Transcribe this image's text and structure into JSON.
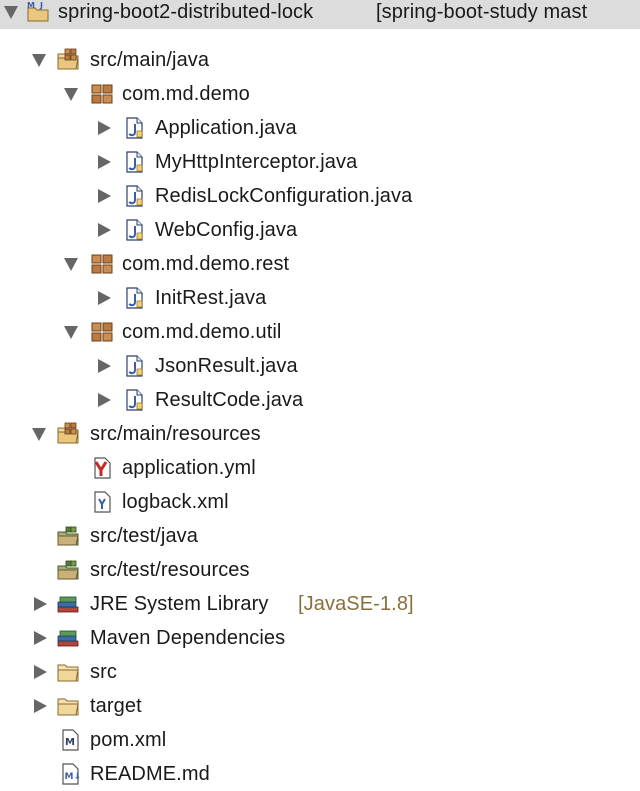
{
  "tree": {
    "project": {
      "label": "spring-boot2-distributed-lock",
      "decoration": "[spring-boot-study mast"
    },
    "items": [
      {
        "label": "src/main/java"
      },
      {
        "label": "com.md.demo"
      },
      {
        "label": "Application.java"
      },
      {
        "label": "MyHttpInterceptor.java"
      },
      {
        "label": "RedisLockConfiguration.java"
      },
      {
        "label": "WebConfig.java"
      },
      {
        "label": "com.md.demo.rest"
      },
      {
        "label": "InitRest.java"
      },
      {
        "label": "com.md.demo.util"
      },
      {
        "label": "JsonResult.java"
      },
      {
        "label": "ResultCode.java"
      },
      {
        "label": "src/main/resources"
      },
      {
        "label": "application.yml"
      },
      {
        "label": "logback.xml"
      },
      {
        "label": "src/test/java"
      },
      {
        "label": "src/test/resources"
      },
      {
        "label": "JRE System Library",
        "decoration": "[JavaSE-1.8]"
      },
      {
        "label": "Maven Dependencies"
      },
      {
        "label": "src"
      },
      {
        "label": "target"
      },
      {
        "label": "pom.xml"
      },
      {
        "label": "README.md"
      }
    ]
  },
  "colors": {
    "selection": "#dcdcdc",
    "twisty": "#666666",
    "decoration": "#8b6f3a",
    "java_file_blue": "#3b5ea8",
    "package_brown": "#8a5a2b",
    "folder_tan": "#e8c98a"
  },
  "icons": {
    "project": "maven-java-project-icon",
    "source_folder": "source-folder-icon",
    "package": "package-icon",
    "java_file": "java-file-icon",
    "enum_file": "java-enum-file-icon",
    "yml_file": "yaml-file-icon",
    "xml_file": "xml-file-icon",
    "test_folder": "test-source-folder-icon",
    "library": "library-icon",
    "folder": "folder-icon",
    "pom": "maven-pom-icon",
    "markdown": "markdown-file-icon"
  }
}
